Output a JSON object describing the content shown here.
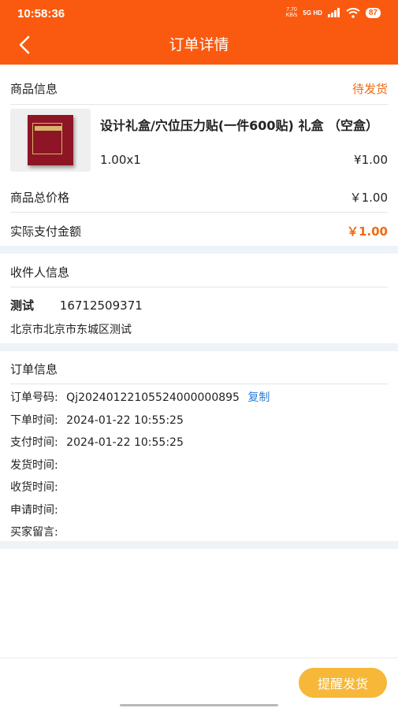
{
  "status_bar": {
    "time": "10:58:36",
    "speed": "7.70",
    "speed_unit": "KB/s",
    "network": "5G HD",
    "battery": "87"
  },
  "header": {
    "title": "订单详情"
  },
  "goods": {
    "section_label": "商品信息",
    "status": "待发货",
    "name": "设计礼盒/穴位压力贴(一件600贴) 礼盒 （空盒）",
    "spec": "1.00x1",
    "price": "¥1.00",
    "total_label": "商品总价格",
    "total_value": "￥1.00",
    "paid_label": "实际支付金额",
    "paid_value": "￥1.00"
  },
  "receiver": {
    "section_label": "收件人信息",
    "name": "测试",
    "phone": "16712509371",
    "address": "北京市北京市东城区测试"
  },
  "order": {
    "section_label": "订单信息",
    "number_label": "订单号码:",
    "number_value": "Qj20240122105524000000895",
    "copy_label": "复制",
    "created_label": "下单时间:",
    "created_value": "2024-01-22 10:55:25",
    "paid_label": "支付时间:",
    "paid_value": "2024-01-22 10:55:25",
    "shipped_label": "发货时间:",
    "received_label": "收货时间:",
    "applied_label": "申请时间:",
    "note_label": "买家留言:"
  },
  "footer": {
    "remind_label": "提醒发货"
  },
  "colors": {
    "header": "#fa5a0f",
    "accent": "#f26a10",
    "button": "#f7b738",
    "link": "#2b7cd8",
    "gap": "#eef3f8"
  }
}
